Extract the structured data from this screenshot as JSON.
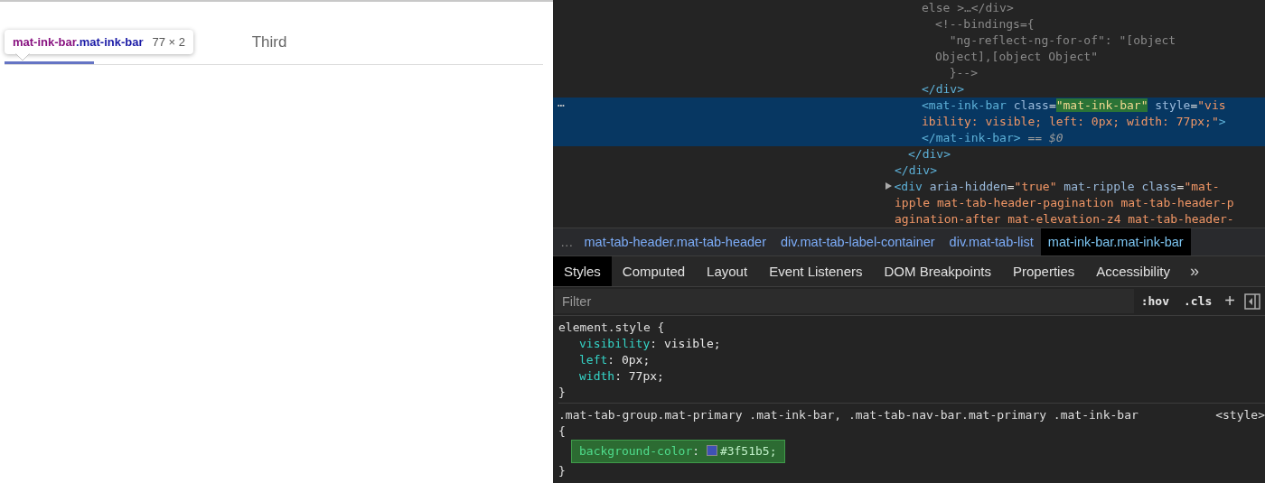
{
  "preview": {
    "tabs": [
      {
        "selected": true
      },
      {
        "selected": false
      },
      {
        "label": "Third",
        "selected": false
      }
    ],
    "tooltip": {
      "tag": "mat-ink-bar",
      "class_name": ".mat-ink-bar",
      "size": "77 × 2"
    }
  },
  "elements_tree": {
    "nodes": [
      {
        "children": [
          {
            "children": [
              {
                "lines": [
                  [
                    {
                      "kind": "comment",
                      "text": "else >…</div>"
                    }
                  ]
                ],
                "children": [
                  {
                    "lines": [
                      [
                        {
                          "kind": "comment",
                          "text": "<!--bindings={"
                        }
                      ],
                      [
                        {
                          "kind": "comment",
                          "text": "  \"ng-reflect-ng-for-of\": \"[object"
                        }
                      ],
                      [
                        {
                          "kind": "comment",
                          "text": "Object],[object Object\""
                        }
                      ],
                      [
                        {
                          "kind": "comment",
                          "text": "  }-->"
                        }
                      ]
                    ]
                  }
                ],
                "close": [
                  {
                    "kind": "tag",
                    "text": "</div>"
                  }
                ]
              },
              {
                "selected": true,
                "gutter": "⋯",
                "lines": [
                  [
                    {
                      "kind": "tag",
                      "text": "<mat-ink-bar"
                    },
                    {
                      "kind": "attr",
                      "text": " class"
                    },
                    {
                      "kind": "plain",
                      "text": "="
                    },
                    {
                      "kind": "value",
                      "text": "\"mat-ink-bar\"",
                      "highlight": true
                    },
                    {
                      "kind": "attr",
                      "text": " style"
                    },
                    {
                      "kind": "plain",
                      "text": "="
                    },
                    {
                      "kind": "value",
                      "text": "\"vis"
                    }
                  ],
                  [
                    {
                      "kind": "value",
                      "text": "ibility: visible; left: 0px; width: 77px;\""
                    },
                    {
                      "kind": "tag",
                      "text": ">"
                    }
                  ],
                  [
                    {
                      "kind": "tag",
                      "text": "</mat-ink-bar>"
                    },
                    {
                      "kind": "ref",
                      "text": " == $0"
                    }
                  ]
                ]
              }
            ],
            "close": [
              {
                "kind": "tag",
                "text": "</div>"
              }
            ]
          }
        ],
        "close": [
          {
            "kind": "tag",
            "text": "</div>"
          }
        ]
      },
      {
        "expanded": false,
        "lines": [
          [
            {
              "kind": "tag",
              "text": "<div"
            },
            {
              "kind": "attr",
              "text": " aria-hidden"
            },
            {
              "kind": "plain",
              "text": "="
            },
            {
              "kind": "value",
              "text": "\"true\""
            },
            {
              "kind": "attr",
              "text": " mat-ripple class"
            },
            {
              "kind": "plain",
              "text": "="
            },
            {
              "kind": "value",
              "text": "\"mat-"
            }
          ],
          [
            {
              "kind": "value",
              "text": "ipple mat-tab-header-pagination mat-tab-header-p"
            }
          ],
          [
            {
              "kind": "value",
              "text": "agination-after mat-elevation-z4 mat-tab-header-"
            }
          ]
        ]
      }
    ]
  },
  "breadcrumbs": {
    "overflow": "…",
    "items": [
      {
        "label": "mat-tab-header.mat-tab-header",
        "selected": false
      },
      {
        "label": "div.mat-tab-label-container",
        "selected": false
      },
      {
        "label": "div.mat-tab-list",
        "selected": false
      },
      {
        "label": "mat-ink-bar.mat-ink-bar",
        "selected": true
      }
    ]
  },
  "panel_tabs": {
    "items": [
      {
        "label": "Styles",
        "selected": true
      },
      {
        "label": "Computed",
        "selected": false
      },
      {
        "label": "Layout",
        "selected": false
      },
      {
        "label": "Event Listeners",
        "selected": false
      },
      {
        "label": "DOM Breakpoints",
        "selected": false
      },
      {
        "label": "Properties",
        "selected": false
      },
      {
        "label": "Accessibility",
        "selected": false
      }
    ],
    "more": "»"
  },
  "filter": {
    "placeholder": "Filter",
    "hov": ":hov",
    "cls": ".cls",
    "add": "+"
  },
  "rules": [
    {
      "selector": "element.style {",
      "close": "}",
      "properties": [
        {
          "name": "visibility",
          "colon": ":",
          "value": "visible;"
        },
        {
          "name": "left",
          "colon": ":",
          "value": "0px;"
        },
        {
          "name": "width",
          "colon": ":",
          "value": "77px;"
        }
      ]
    },
    {
      "selector": ".mat-tab-group.mat-primary .mat-ink-bar, .mat-tab-nav-bar.mat-primary .mat-ink-bar",
      "source": "<style>",
      "open": "{",
      "close": "}",
      "properties": [
        {
          "name": "background-color",
          "colon": ":",
          "value": "#3f51b5;",
          "color": "#3f51b5",
          "highlight": true
        }
      ]
    }
  ]
}
